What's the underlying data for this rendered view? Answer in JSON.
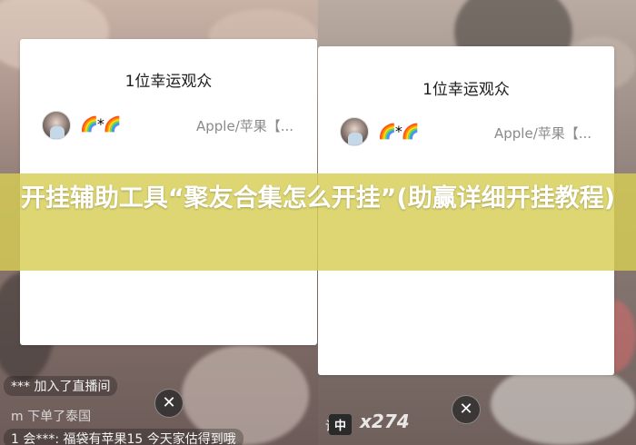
{
  "dialog_title": "1位幸运观众",
  "winner": {
    "nickname": "🌈*🌈",
    "prize": "Apple/苹果【..."
  },
  "close_symbol": "✕",
  "banner": {
    "text": "开挂辅助工具“聚友合集怎么开挂”(助赢详细开挂教程)"
  },
  "chat": {
    "join_msg": "*** 加入了直播间",
    "row2": "m         下单了泰国",
    "row3": "1 会***: 福袋有苹果15    今天家估得到哦",
    "right_badge": "中",
    "right_prefix": "说",
    "right_ticker": "x274"
  },
  "colors": {
    "banner_bg": "#d6cd54",
    "card_bg": "#ffffff"
  }
}
